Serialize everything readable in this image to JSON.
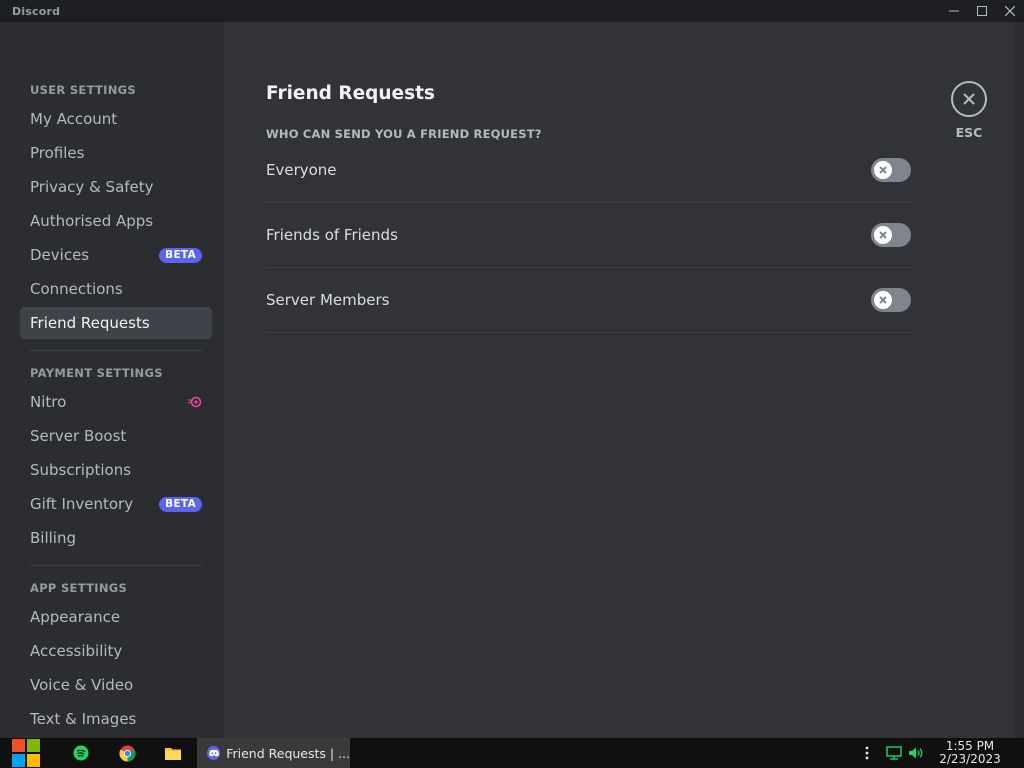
{
  "window": {
    "app_name": "Discord"
  },
  "sidebar": {
    "sections": [
      {
        "header": "USER SETTINGS"
      },
      {
        "header": "PAYMENT SETTINGS"
      },
      {
        "header": "APP SETTINGS"
      }
    ],
    "items": [
      {
        "label": "My Account"
      },
      {
        "label": "Profiles"
      },
      {
        "label": "Privacy & Safety"
      },
      {
        "label": "Authorised Apps"
      },
      {
        "label": "Devices",
        "badge": "BETA"
      },
      {
        "label": "Connections"
      },
      {
        "label": "Friend Requests",
        "selected": true
      },
      {
        "label": "Nitro",
        "icon": "nitro-icon"
      },
      {
        "label": "Server Boost"
      },
      {
        "label": "Subscriptions"
      },
      {
        "label": "Gift Inventory",
        "badge": "BETA"
      },
      {
        "label": "Billing"
      },
      {
        "label": "Appearance"
      },
      {
        "label": "Accessibility"
      },
      {
        "label": "Voice & Video"
      },
      {
        "label": "Text & Images"
      }
    ]
  },
  "content": {
    "title": "Friend Requests",
    "subheader": "WHO CAN SEND YOU A FRIEND REQUEST?",
    "options": [
      {
        "label": "Everyone",
        "enabled": false
      },
      {
        "label": "Friends of Friends",
        "enabled": false
      },
      {
        "label": "Server Members",
        "enabled": false
      }
    ],
    "close_label": "ESC"
  },
  "taskbar": {
    "active_task": "Friend Requests | ...",
    "time": "1:55 PM",
    "date": "2/23/2023"
  },
  "colors": {
    "accent": "#5865f2",
    "sidebar_bg": "#2b2d31",
    "content_bg": "#313338",
    "nitro_pink": "#eb459f",
    "toggle_off": "#80848e"
  }
}
